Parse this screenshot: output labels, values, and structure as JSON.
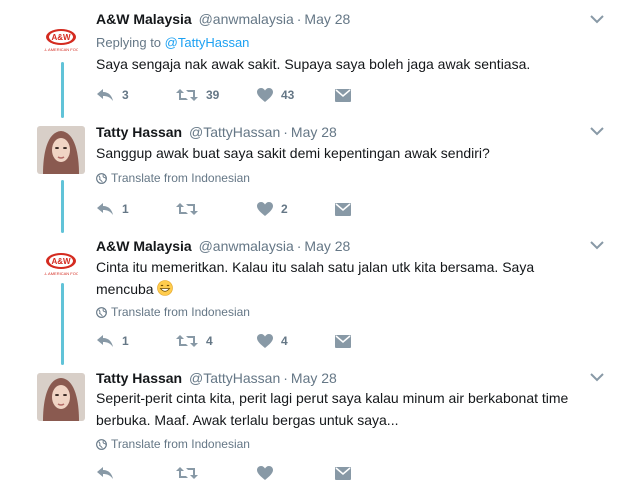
{
  "colors": {
    "accent": "#1da1f2",
    "thread": "#61c3d8",
    "muted": "#657786",
    "text": "#14171a"
  },
  "tweets": [
    {
      "name": "A&W Malaysia",
      "handle": "@anwmalaysia",
      "dot": "·",
      "time": "May 28",
      "replying_prefix": "Replying to",
      "replying_to": "@TattyHassan",
      "text": "Saya sengaja nak awak sakit. Supaya saya boleh jaga awak sentiasa.",
      "translate": "",
      "reply_count": "3",
      "retweet_count": "39",
      "like_count": "43",
      "avatar": "aw-logo-icon"
    },
    {
      "name": "Tatty Hassan",
      "handle": "@TattyHassan",
      "dot": "·",
      "time": "May 28",
      "text": "Sanggup awak buat saya sakit demi kepentingan awak sendiri?",
      "translate": "Translate from Indonesian",
      "reply_count": "1",
      "retweet_count": "",
      "like_count": "2",
      "avatar": "user-photo"
    },
    {
      "name": "A&W Malaysia",
      "handle": "@anwmalaysia",
      "dot": "·",
      "time": "May 28",
      "text_line1": "Cinta itu memeritkan. Kalau itu salah satu jalan utk kita bersama. Saya",
      "text_line2": "mencuba",
      "translate": "Translate from Indonesian",
      "reply_count": "1",
      "retweet_count": "4",
      "like_count": "4",
      "avatar": "aw-logo-icon"
    },
    {
      "name": "Tatty Hassan",
      "handle": "@TattyHassan",
      "dot": "·",
      "time": "May 28",
      "text_line1": "Seperit-perit cinta kita, perit lagi perut saya kalau minum air berkabonat time",
      "text_line2": "berbuka. Maaf. Awak terlalu bergas untuk saya...",
      "translate": "Translate from Indonesian",
      "avatar": "user-photo"
    }
  ],
  "aw_logo_text": "A&W",
  "aw_logo_subtext": "ALL AMERICAN FOOD"
}
